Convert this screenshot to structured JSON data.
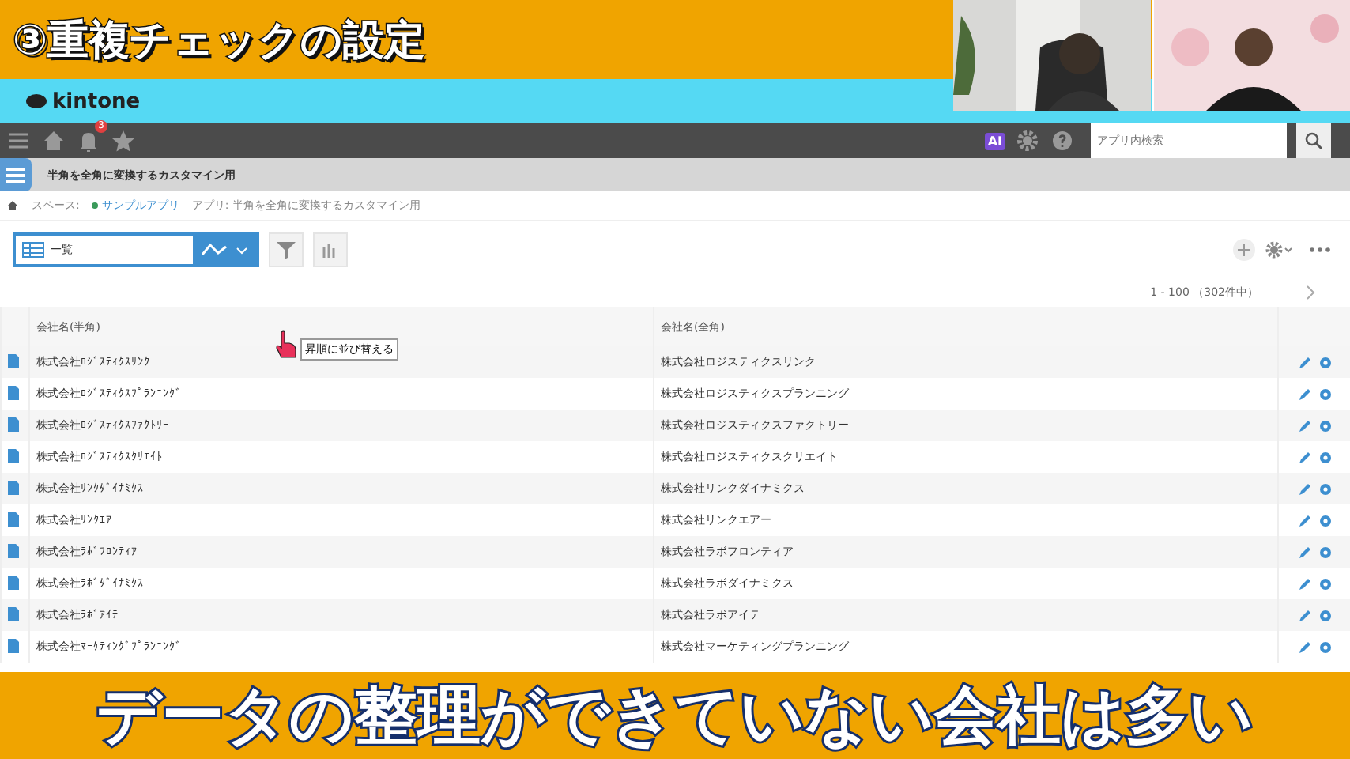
{
  "video_title": "③重複チェックの設定",
  "brand": "kintone",
  "nav": {
    "badge": "3",
    "ai_label": "AI",
    "search": {
      "placeholder": "アプリ内検索"
    }
  },
  "app_title": "半角を全角に変換するカスタマイン用",
  "breadcrumb": {
    "space_label": "スペース:",
    "space_name": "サンプルアプリ",
    "app": "アプリ: 半角を全角に変換するカスタマイン用"
  },
  "view_select": "一覧",
  "pagination": "1 - 100 （302件中）",
  "table": {
    "columns": [
      "会社名(半角)",
      "会社名(全角)"
    ],
    "tooltip": "昇順に並び替える",
    "rows": [
      {
        "half": "株式会社ﾛｼﾞｽﾃｨｸｽﾘﾝｸ",
        "full": "株式会社ロジスティクスリンク"
      },
      {
        "half": "株式会社ﾛｼﾞｽﾃｨｸｽﾌﾟﾗﾝﾆﾝｸﾞ",
        "full": "株式会社ロジスティクスプランニング"
      },
      {
        "half": "株式会社ﾛｼﾞｽﾃｨｸｽﾌｧｸﾄﾘｰ",
        "full": "株式会社ロジスティクスファクトリー"
      },
      {
        "half": "株式会社ﾛｼﾞｽﾃｨｸｽｸﾘｴｲﾄ",
        "full": "株式会社ロジスティクスクリエイト"
      },
      {
        "half": "株式会社ﾘﾝｸﾀﾞｲﾅﾐｸｽ",
        "full": "株式会社リンクダイナミクス"
      },
      {
        "half": "株式会社ﾘﾝｸｴｱｰ",
        "full": "株式会社リンクエアー"
      },
      {
        "half": "株式会社ﾗﾎﾞﾌﾛﾝﾃｨｱ",
        "full": "株式会社ラボフロンティア"
      },
      {
        "half": "株式会社ﾗﾎﾞﾀﾞｲﾅﾐｸｽ",
        "full": "株式会社ラボダイナミクス"
      },
      {
        "half": "株式会社ﾗﾎﾞｱｲﾃ",
        "full": "株式会社ラボアイテ"
      },
      {
        "half": "株式会社ﾏｰｹﾃｨﾝｸﾞﾌﾟﾗﾝﾆﾝｸﾞ",
        "full": "株式会社マーケティングプランニング"
      }
    ]
  },
  "caption": "データの整理ができていない会社は多い"
}
